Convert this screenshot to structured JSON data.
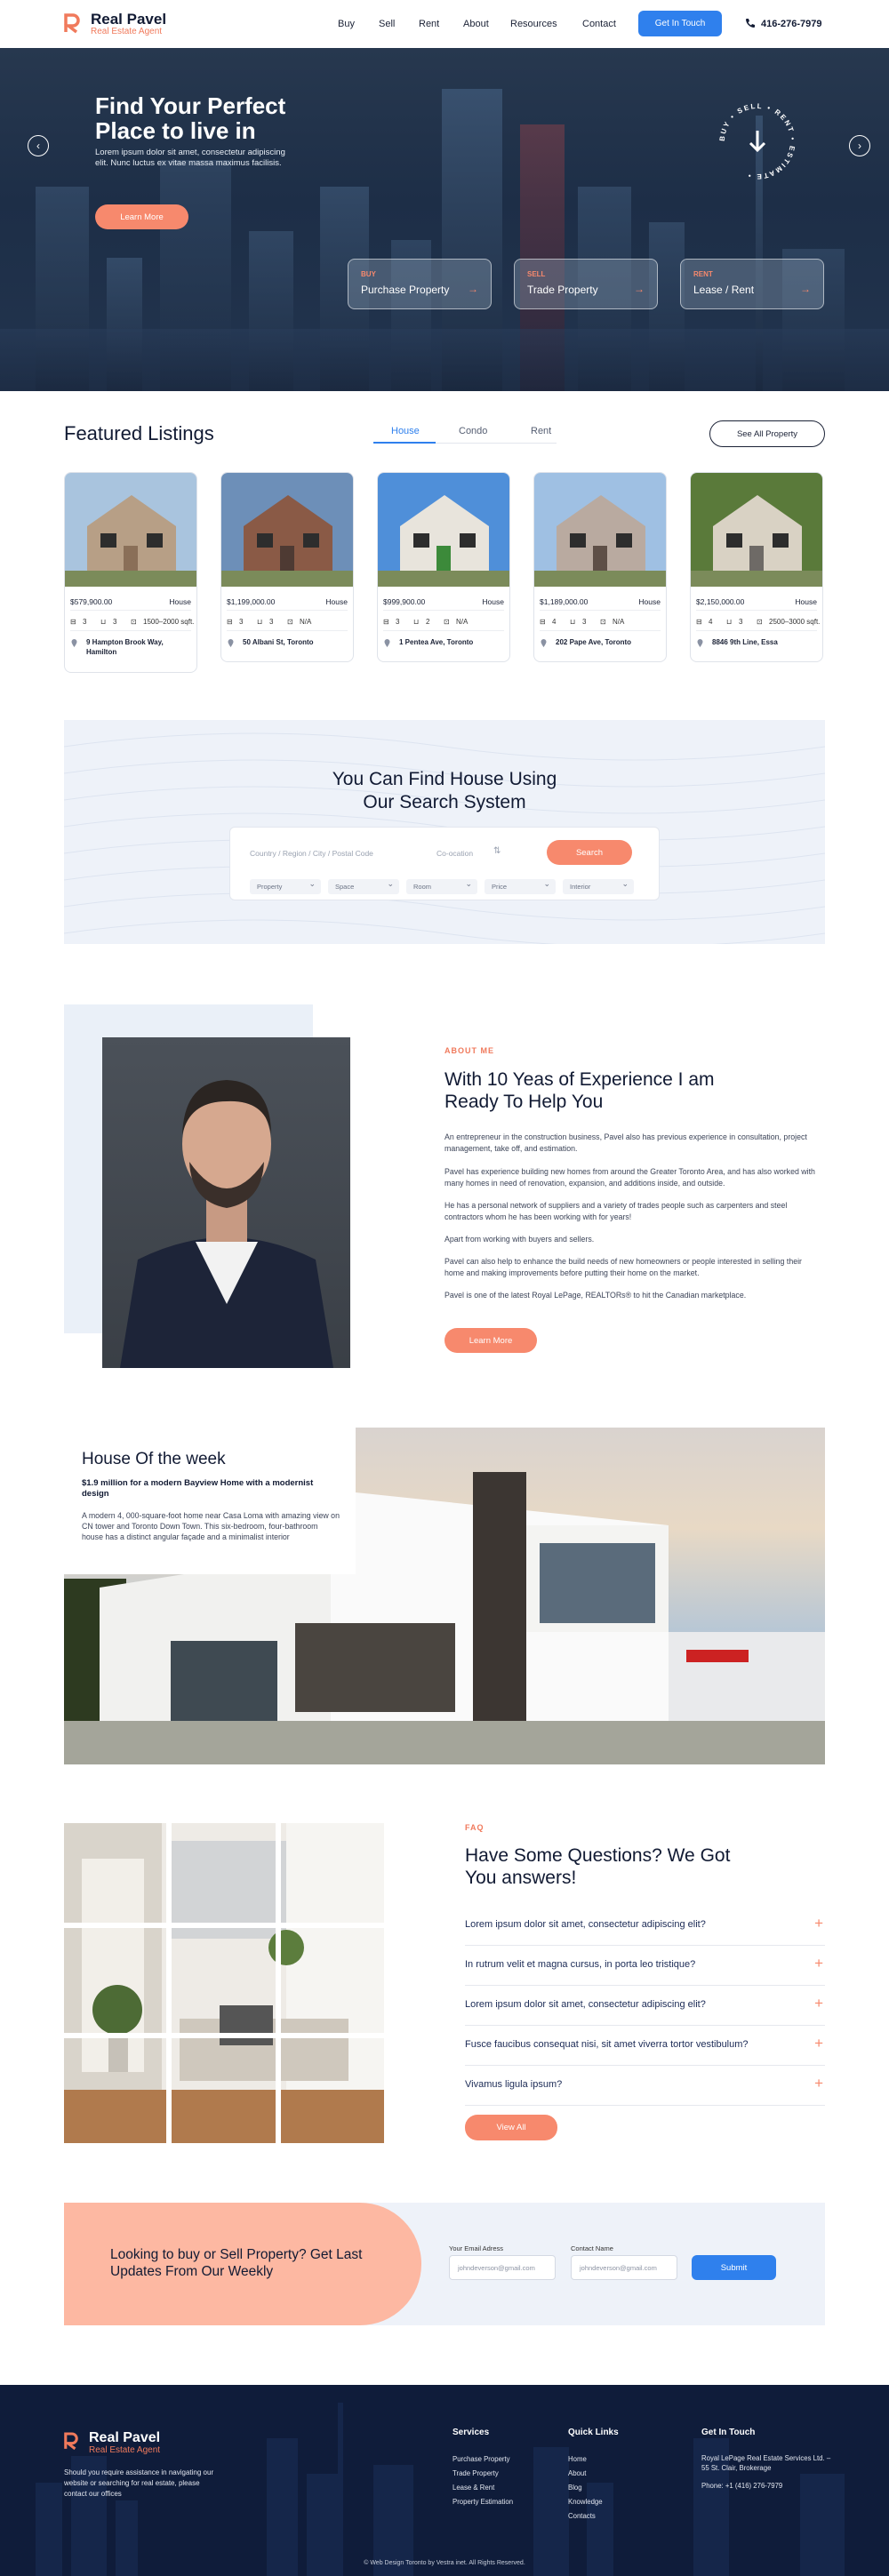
{
  "header": {
    "logo_title": "Real Pavel",
    "logo_sub": "Real Estate Agent",
    "nav": [
      "Buy",
      "Sell",
      "Rent",
      "About",
      "Resources",
      "Contact"
    ],
    "cta": "Get In Touch",
    "phone": "416-276-7979"
  },
  "hero": {
    "title": "Find Your Perfect Place to live in",
    "text": "Lorem ipsum dolor sit amet, consectetur adipiscing elit. Nunc luctus ex vitae massa maximus facilisis.",
    "button": "Learn More",
    "badge_text": "BUY • SELL • RENT • ESTIMATE •",
    "cards": [
      {
        "kicker": "BUY",
        "label": "Purchase Property"
      },
      {
        "kicker": "SELL",
        "label": "Trade Property"
      },
      {
        "kicker": "RENT",
        "label": "Lease / Rent"
      }
    ]
  },
  "featured": {
    "title": "Featured Listings",
    "tabs": [
      "House",
      "Condo",
      "Rent"
    ],
    "see_all": "See All Property",
    "cards": [
      {
        "price": "$579,900.00",
        "type": "House",
        "beds": "3",
        "baths": "3",
        "size": "1500–2000 sqft.",
        "address": "9 Hampton Brook Way, Hamilton"
      },
      {
        "price": "$1,199,000.00",
        "type": "House",
        "beds": "3",
        "baths": "3",
        "size": "N/A",
        "address": "50 Albani St, Toronto"
      },
      {
        "price": "$999,900.00",
        "type": "House",
        "beds": "3",
        "baths": "2",
        "size": "N/A",
        "address": "1 Pentea Ave, Toronto"
      },
      {
        "price": "$1,189,000.00",
        "type": "House",
        "beds": "4",
        "baths": "3",
        "size": "N/A",
        "address": "202 Pape Ave, Toronto"
      },
      {
        "price": "$2,150,000.00",
        "type": "House",
        "beds": "4",
        "baths": "3",
        "size": "2500–3000 sqft.",
        "address": "8846 9th Line, Essa"
      }
    ]
  },
  "search": {
    "title_line1": "You Can Find House Using",
    "title_line2": "Our Search System",
    "input_placeholder": "Country / Region / City / Postal Code",
    "geo": "Co-ocation",
    "button": "Search",
    "filters": [
      "Property",
      "Space",
      "Room",
      "Price",
      "Interior"
    ]
  },
  "about": {
    "label": "ABOUT ME",
    "title": "With 10 Yeas  of Experience I am Ready To Help You",
    "paragraphs": [
      "An entrepreneur in the construction business, Pavel also has previous experience in consultation, project management, take off, and estimation.",
      "Pavel has experience building new homes from around the Greater Toronto Area, and has also worked with many homes in need of renovation, expansion, and additions inside, and outside.",
      "He has a personal network of suppliers and a variety of trades people such as carpenters and steel contractors whom he has been working with for years!",
      "Apart from working with buyers and sellers.",
      "Pavel can also help to enhance the build needs of new homeowners or people interested in selling their home and making improvements before putting their home on the market.",
      "Pavel is one of the latest Royal LePage, REALTORs® to hit the Canadian marketplace."
    ],
    "button": "Learn More"
  },
  "house_of_week": {
    "title": "House Of the week",
    "subtitle": "$1.9 million for a modern Bayview Home with a modernist design",
    "text": "A modern 4, 000-square-foot home near Casa Loma with amazing view on CN tower and Toronto Down Town.  This six-bedroom, four-bathroom house has a distinct angular façade and a minimalist interior"
  },
  "faq": {
    "label": "FAQ",
    "title": "Have Some Questions? We Got You answers!",
    "questions": [
      "Lorem ipsum dolor sit amet, consectetur adipiscing elit?",
      "In rutrum velit et magna cursus, in porta leo tristique?",
      "Lorem ipsum dolor sit amet, consectetur adipiscing elit?",
      "Fusce faucibus consequat nisi, sit amet viverra tortor vestibulum?",
      "Vivamus ligula ipsum?"
    ],
    "button": "View All"
  },
  "newsletter": {
    "title": "Looking to buy or Sell Property? Get Last Updates From Our Weekly",
    "email_label": "Your Email Adress",
    "email_placeholder": "johndeverson@gmail.com",
    "contact_label": "Contact Name",
    "contact_placeholder": "johndeverson@gmail.com",
    "button": "Submit"
  },
  "footer": {
    "logo_title": "Real Pavel",
    "logo_sub": "Real Estate Agent",
    "desc": "Should you require assistance in navigating our website or searching for real estate, please contact our offices",
    "services_title": "Services",
    "services": [
      "Purchase Property",
      "Trade Property",
      "Lease & Rent",
      "Property Estimation"
    ],
    "quick_title": "Quick Links",
    "quick": [
      "Home",
      "About",
      "Blog",
      "Knowledge",
      "Contacts"
    ],
    "touch_title": "Get In Touch",
    "address": "Royal LePage Real Estate Services Ltd. – 55 St. Clair, Brokerage",
    "phone": "Phone: +1 (416) 276-7979",
    "copyright": "© Web Design Toronto by Vestra inet. All Rights Reserved."
  },
  "colors": {
    "accent": "#f7896d",
    "primary": "#2f80ed",
    "navy": "#0f1c3a"
  }
}
